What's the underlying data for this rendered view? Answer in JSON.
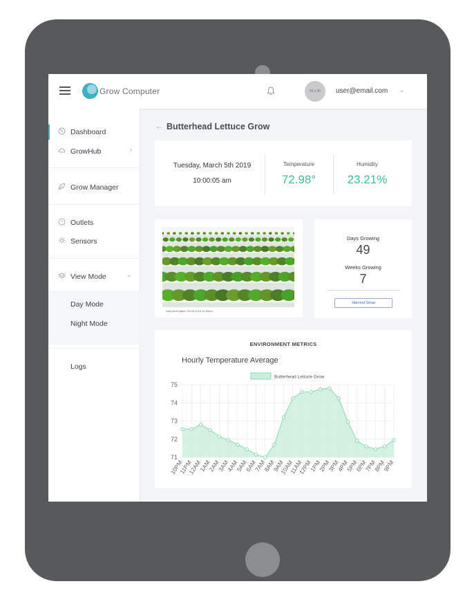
{
  "app": {
    "name": "Grow Computer"
  },
  "header": {
    "avatar_text": "36 x 36",
    "user_email": "user@email.com"
  },
  "sidebar": {
    "items": [
      {
        "label": "Dashboard",
        "icon": "dashboard-icon",
        "active": true
      },
      {
        "label": "GrowHub",
        "icon": "cloud-icon",
        "has_chevron": true
      },
      {
        "label": "Grow Manager",
        "icon": "leaf-icon"
      },
      {
        "label": "Outlets",
        "icon": "power-icon"
      },
      {
        "label": "Sensors",
        "icon": "sun-icon"
      },
      {
        "label": "View Mode",
        "icon": "layers-icon",
        "expanded": true
      },
      {
        "label": "Logs"
      }
    ],
    "view_mode_options": [
      "Day Mode",
      "Night Mode"
    ]
  },
  "page": {
    "title": "Butterhead Lettuce Grow"
  },
  "status": {
    "date": "Tuesday, March 5th 2019",
    "time": "10:00:05 am",
    "temperature_label": "Temperature",
    "temperature_value": "72.98°",
    "humidity_label": "Humidity",
    "humidity_value": "23.21%"
  },
  "photo": {
    "caption": "Last photo taken 03-05-2019 10:00am"
  },
  "growth": {
    "days_label": "Days Growing",
    "days_value": "49",
    "weeks_label": "Weeks Growing",
    "weeks_value": "7",
    "harvest_button": "Harvest Grow"
  },
  "metrics": {
    "section_title": "ENVIRONMENT METRICS"
  },
  "colors": {
    "accent": "#3cc09c",
    "line": "#a6e3c7",
    "fill": "#cdeedd",
    "link": "#3a5bbf"
  },
  "chart_data": {
    "type": "area",
    "title": "Hourly Temperature Average",
    "categories": [
      "10PM",
      "11PM",
      "12AM",
      "1AM",
      "2AM",
      "3AM",
      "4AM",
      "5AM",
      "6AM",
      "7AM",
      "8AM",
      "9AM",
      "10AM",
      "11AM",
      "12PM",
      "1PM",
      "2PM",
      "3PM",
      "4PM",
      "5PM",
      "6PM",
      "7PM",
      "8PM",
      "9PM"
    ],
    "series": [
      {
        "name": "Butterhead Lettuce Grow",
        "values": [
          72.55,
          72.55,
          72.8,
          72.5,
          72.15,
          71.95,
          71.7,
          71.45,
          71.15,
          71.0,
          71.7,
          73.2,
          74.25,
          74.6,
          74.6,
          74.75,
          74.8,
          74.25,
          72.95,
          71.9,
          71.6,
          71.45,
          71.6,
          71.95
        ]
      }
    ],
    "ylim": [
      71,
      75
    ],
    "yticks": [
      71,
      72,
      73,
      74,
      75
    ],
    "grid": true,
    "legend": "top"
  }
}
